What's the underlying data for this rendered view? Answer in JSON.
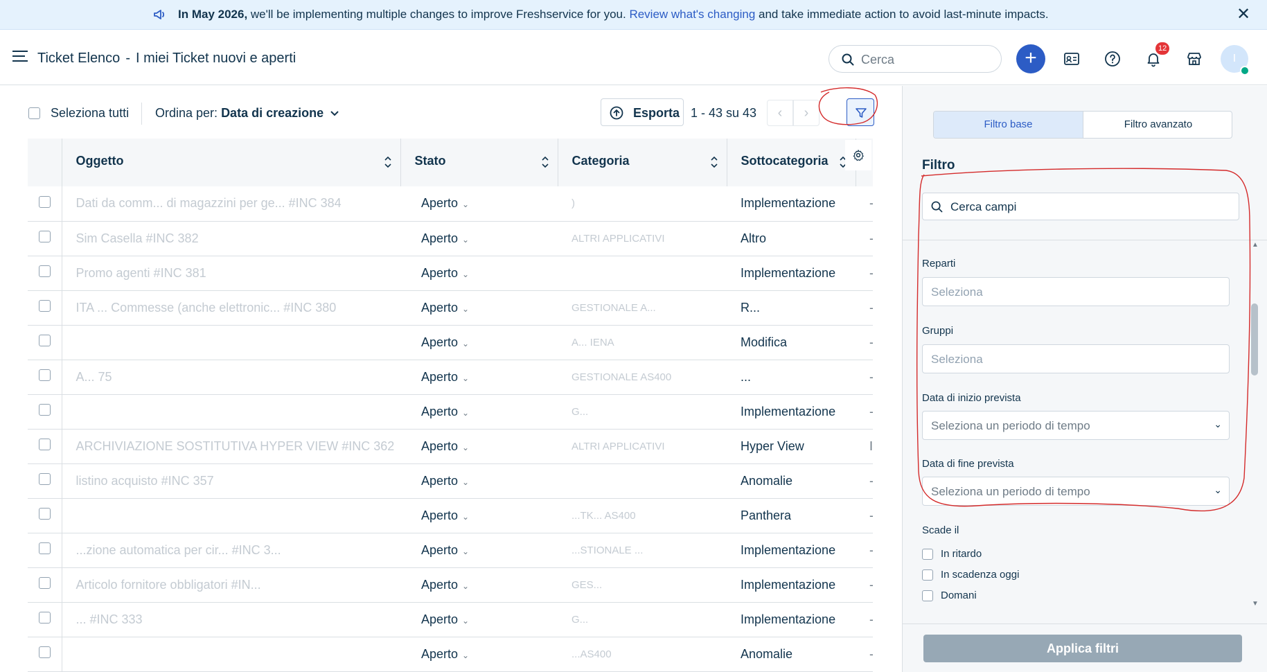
{
  "banner": {
    "bold": "In May 2026,",
    "text": " we'll be implementing multiple changes to improve Freshservice for you. ",
    "link": "Review what's changing",
    "tail": " and take immediate action to avoid last-minute impacts."
  },
  "header": {
    "title": "Ticket Elenco",
    "separator": "-",
    "subtitle": "I miei Ticket nuovi e aperti",
    "search_placeholder": "Cerca",
    "notification_count": "12",
    "avatar_initial": "I"
  },
  "toolbar": {
    "select_all": "Seleziona tutti",
    "sort_prefix": "Ordina per:",
    "sort_value": "Data di creazione",
    "export": "Esporta",
    "pagination": "1 - 43 su 43"
  },
  "table": {
    "columns": [
      "Oggetto",
      "Stato",
      "Categoria",
      "Sottocategoria"
    ],
    "rows": [
      {
        "subject": "Dati da comm... di magazzini per ge... #INC 384",
        "status": "Aperto",
        "category": ")",
        "subcategory": "Implementazione",
        "extra": "-"
      },
      {
        "subject": "Sim Casella #INC 382",
        "status": "Aperto",
        "category": "ALTRI APPLICATIVI",
        "subcategory": "Altro",
        "extra": "-"
      },
      {
        "subject": "Promo agenti #INC 381",
        "status": "Aperto",
        "category": "",
        "subcategory": "Implementazione",
        "extra": "-"
      },
      {
        "subject": "ITA ... Commesse (anche elettronic... #INC 380",
        "status": "Aperto",
        "category": "GESTIONALE A...",
        "subcategory": "R...",
        "extra": "-"
      },
      {
        "subject": "",
        "status": "Aperto",
        "category": "A... IENA",
        "subcategory": "Modifica",
        "extra": "-"
      },
      {
        "subject": "A... 75",
        "status": "Aperto",
        "category": "GESTIONALE AS400",
        "subcategory": "...",
        "extra": "-"
      },
      {
        "subject": "",
        "status": "Aperto",
        "category": "G...",
        "subcategory": "Implementazione",
        "extra": "-"
      },
      {
        "subject": "ARCHIVIAZIONE SOSTITUTIVA HYPER VIEW #INC 362",
        "status": "Aperto",
        "category": "ALTRI APPLICATIVI",
        "subcategory": "Hyper View",
        "extra": "I"
      },
      {
        "subject": "listino acquisto #INC 357",
        "status": "Aperto",
        "category": "",
        "subcategory": "Anomalie",
        "extra": "-"
      },
      {
        "subject": "",
        "status": "Aperto",
        "category": "...TK... AS400",
        "subcategory": "Panthera",
        "extra": "-"
      },
      {
        "subject": "...zione automatica per cir... #INC 3...",
        "status": "Aperto",
        "category": "...STIONALE ...",
        "subcategory": "Implementazione",
        "extra": "-"
      },
      {
        "subject": "Articolo fornitore obbligatori #IN...",
        "status": "Aperto",
        "category": "GES...",
        "subcategory": "Implementazione",
        "extra": "-"
      },
      {
        "subject": "... #INC 333",
        "status": "Aperto",
        "category": "G...",
        "subcategory": "Implementazione",
        "extra": "-"
      },
      {
        "subject": "",
        "status": "Aperto",
        "category": "...AS400",
        "subcategory": "Anomalie",
        "extra": "-"
      }
    ]
  },
  "filter": {
    "tab_basic": "Filtro base",
    "tab_advanced": "Filtro avanzato",
    "title": "Filtro",
    "search_placeholder": "Cerca campi",
    "fields": [
      {
        "label": "Reparti",
        "placeholder": "Seleziona"
      },
      {
        "label": "Gruppi",
        "placeholder": "Seleziona"
      },
      {
        "label": "Data di inizio prevista",
        "placeholder": "Seleziona un periodo di tempo"
      },
      {
        "label": "Data di fine prevista",
        "placeholder": "Seleziona un periodo di tempo"
      }
    ],
    "due_label": "Scade il",
    "due_options": [
      "In ritardo",
      "In scadenza oggi",
      "Domani"
    ],
    "apply": "Applica filtri"
  },
  "colors": {
    "accent": "#2c5cc5",
    "banner_bg": "#e5f2fd",
    "annotation": "#d42a2a",
    "apply_disabled": "#97a8b5"
  }
}
